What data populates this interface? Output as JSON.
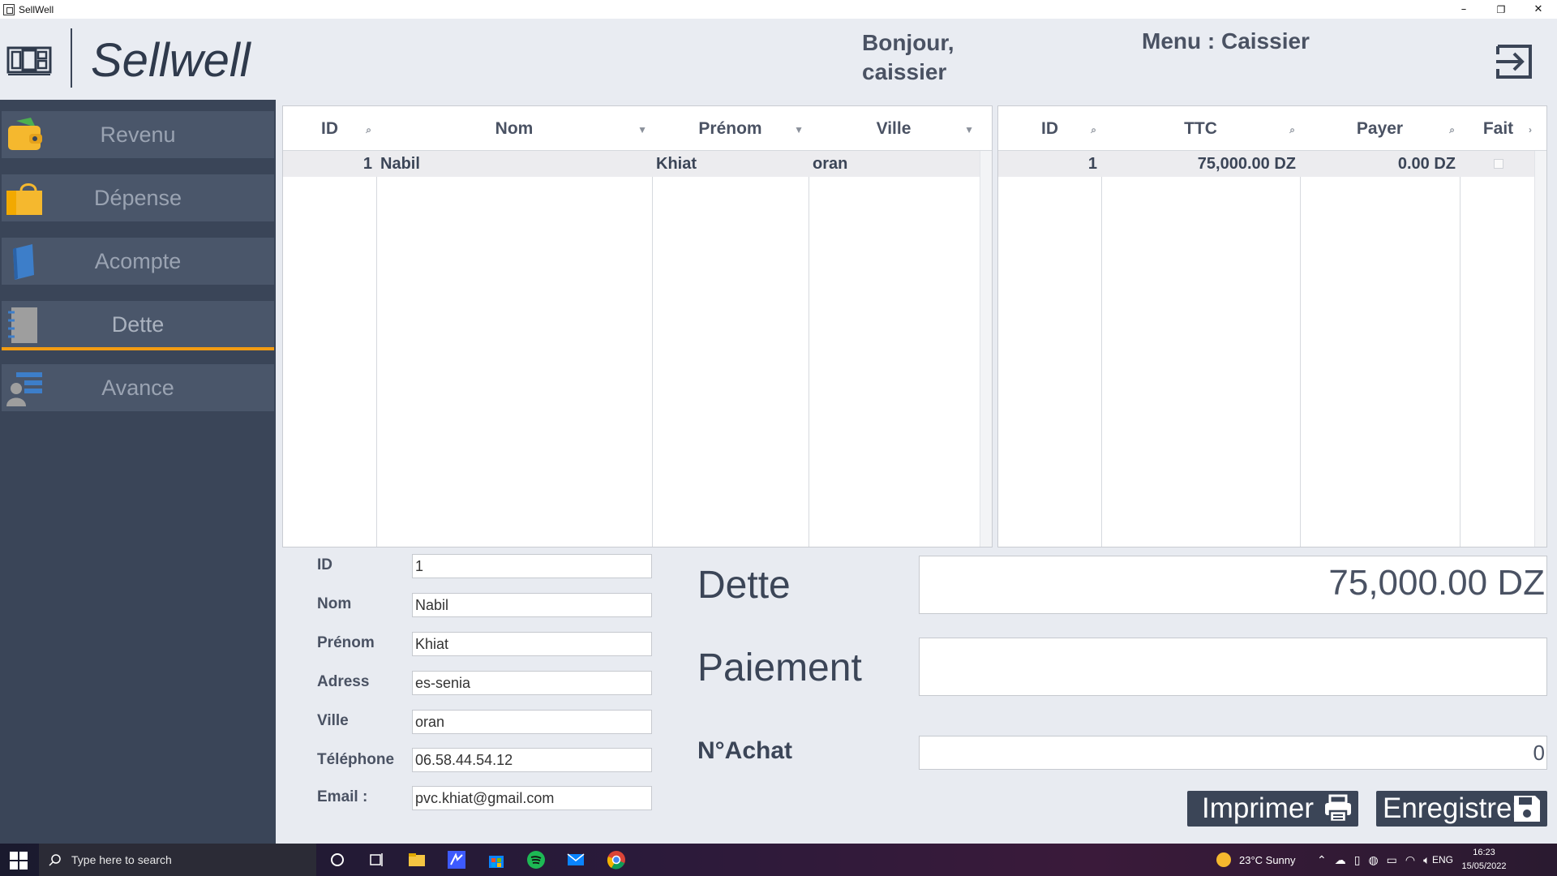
{
  "window": {
    "title": "SellWell",
    "controls": {
      "minimize": "–",
      "restore": "❐",
      "close": "✕"
    }
  },
  "header": {
    "brand": "Sellwell",
    "greeting": "Bonjour, caissier",
    "menu": "Menu : Caissier",
    "logout_icon": "logout-icon"
  },
  "sidebar": {
    "items": [
      {
        "label": "Revenu",
        "icon": "wallet-icon"
      },
      {
        "label": "Dépense",
        "icon": "shopping-bag-icon"
      },
      {
        "label": "Acompte",
        "icon": "book-icon"
      },
      {
        "label": "Dette",
        "icon": "notebook-icon",
        "active": true
      },
      {
        "label": "Avance",
        "icon": "user-list-icon"
      }
    ],
    "active_color": "#f39c12"
  },
  "clients_table": {
    "columns": [
      "ID",
      "Nom",
      "Prénom",
      "Ville"
    ],
    "rows": [
      {
        "id": "1",
        "nom": "Nabil",
        "prenom": "Khiat",
        "ville": "oran"
      }
    ]
  },
  "debts_table": {
    "columns": [
      "ID",
      "TTC",
      "Payer",
      "Fait"
    ],
    "rows": [
      {
        "id": "1",
        "ttc": "75,000.00 DZ",
        "payer": "0.00 DZ",
        "fait": false
      }
    ]
  },
  "form": {
    "fields": [
      {
        "label": "ID",
        "value": "1"
      },
      {
        "label": "Nom",
        "value": "Nabil"
      },
      {
        "label": "Prénom",
        "value": "Khiat"
      },
      {
        "label": "Adress",
        "value": "es-senia"
      },
      {
        "label": "Ville",
        "value": "oran"
      },
      {
        "label": "Téléphone",
        "value": "06.58.44.54.12"
      },
      {
        "label": "Email :",
        "value": "pvc.khiat@gmail.com"
      }
    ]
  },
  "summary": {
    "dette_label": "Dette",
    "dette_value": "75,000.00 DZ",
    "paiement_label": "Paiement",
    "paiement_value": "",
    "achat_label": "N°Achat",
    "achat_value": "0"
  },
  "actions": {
    "print_label": "Imprimer",
    "save_label": "Enregistrer"
  },
  "taskbar": {
    "search_placeholder": "Type here to search",
    "weather": "23°C  Sunny",
    "language": "ENG",
    "time": "16:23",
    "date": "15/05/2022"
  }
}
